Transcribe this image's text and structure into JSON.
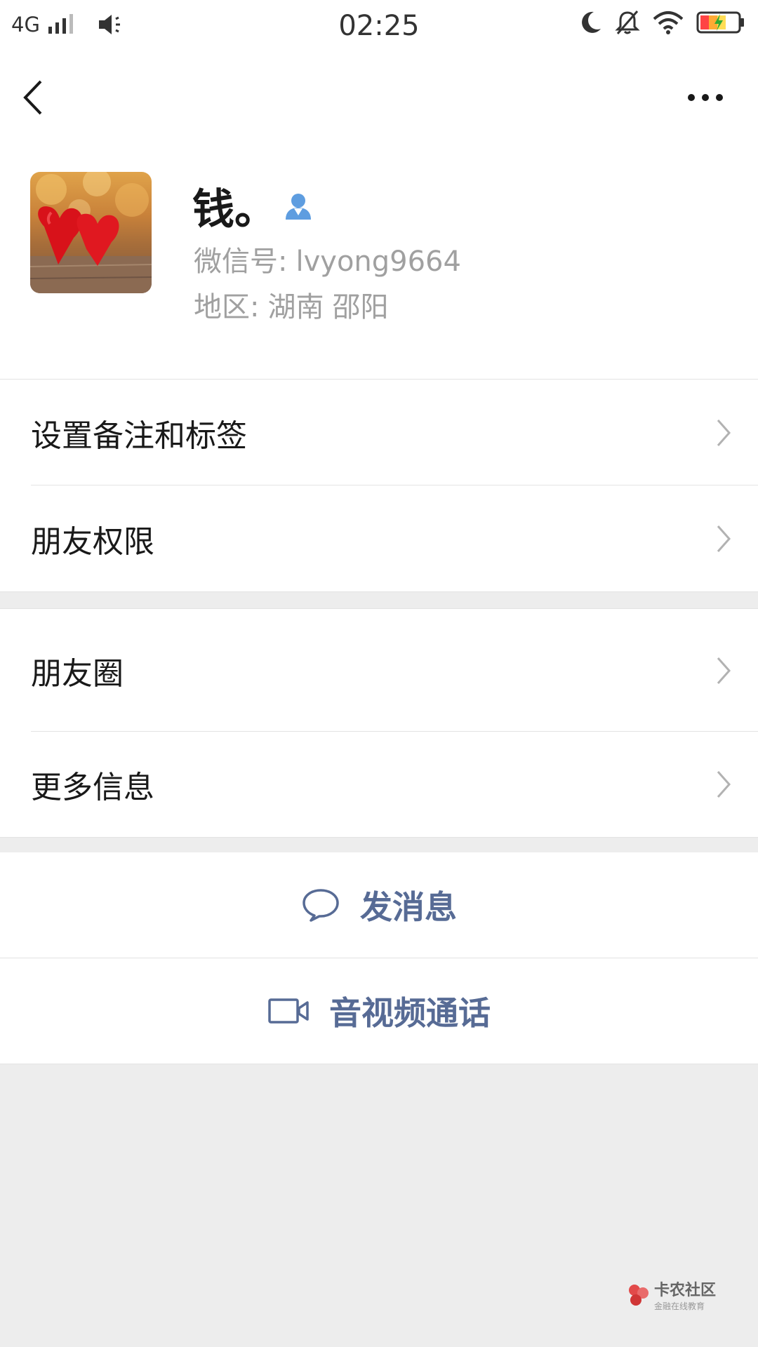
{
  "status_bar": {
    "network": "4G",
    "time": "02:25"
  },
  "nav": {
    "back_icon": "chevron-left-icon",
    "more_icon": "more-dots-icon"
  },
  "profile": {
    "name": "钱。",
    "wechat_id_label": "微信号:",
    "wechat_id": "lvyong9664",
    "region_label": "地区:",
    "region_province": "湖南",
    "region_city": "邵阳"
  },
  "menu": {
    "remark_tags": "设置备注和标签",
    "friend_permissions": "朋友权限",
    "moments": "朋友圈",
    "more_info": "更多信息"
  },
  "actions": {
    "send_message": "发消息",
    "video_call": "音视频通话"
  },
  "watermark": {
    "title": "卡农社区",
    "subtitle": "金融在线教育"
  },
  "colors": {
    "link_blue": "#576b95",
    "gray_text": "#a0a0a0",
    "background": "#ededed"
  }
}
